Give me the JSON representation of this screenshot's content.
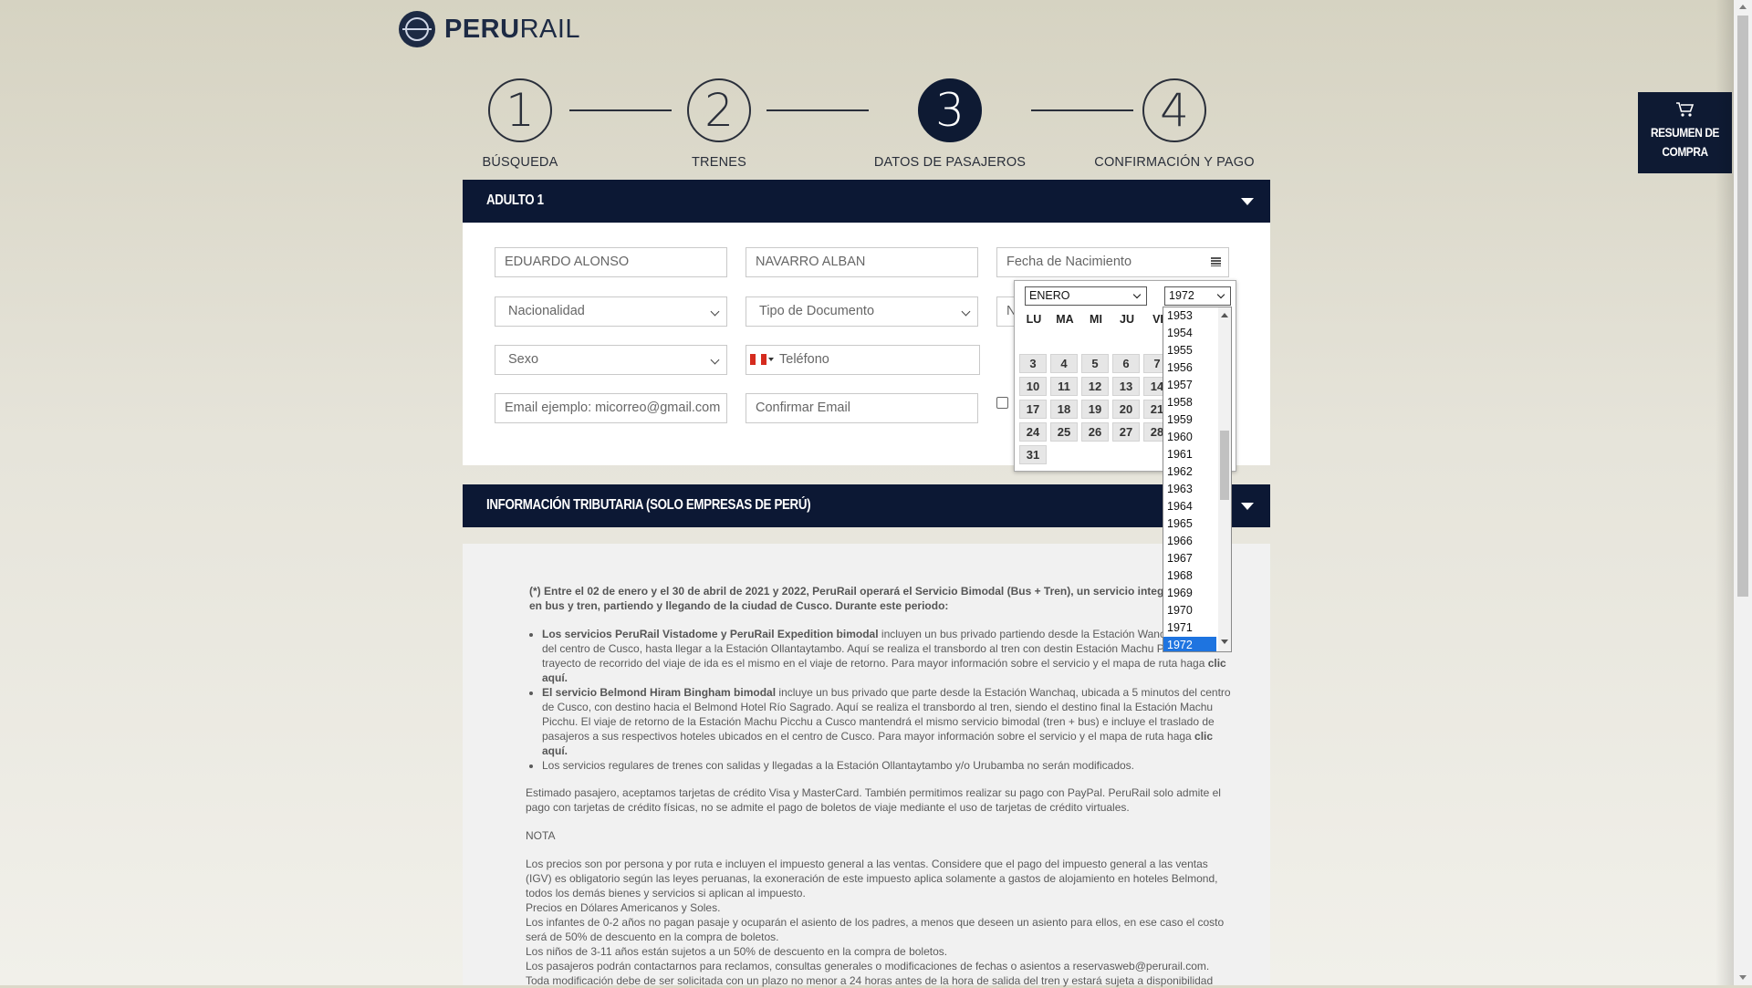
{
  "brand": {
    "bold": "PERU",
    "light": "RAIL"
  },
  "steps": [
    {
      "number": "1",
      "label": "BÚSQUEDA"
    },
    {
      "number": "2",
      "label": "TRENES"
    },
    {
      "number": "3",
      "label": "DATOS DE PASAJEROS"
    },
    {
      "number": "4",
      "label": "CONFIRMACIÓN Y PAGO"
    }
  ],
  "active_step": 3,
  "cart": {
    "line1": "RESUMEN DE",
    "line2": "COMPRA"
  },
  "passenger": {
    "title": "ADULTO 1",
    "first_name": "EDUARDO ALONSO",
    "last_name": "NAVARRO ALBAN",
    "birthdate_placeholder": "Fecha de Nacimiento",
    "nationality": "Nacionalidad",
    "document_type": "Tipo de Documento",
    "doc_number_partial": "N",
    "sex": "Sexo",
    "phone_placeholder": "Teléfono",
    "email_placeholder": "Email ejemplo: micorreo@gmail.com",
    "confirm_email_placeholder": "Confirmar Email"
  },
  "datepicker": {
    "month": "ENERO",
    "year": "1972",
    "weekdays": [
      "LU",
      "MA",
      "MI",
      "JU",
      "VI"
    ],
    "weeks": [
      [
        "",
        "",
        "",
        "",
        ""
      ],
      [
        "3",
        "4",
        "5",
        "6",
        "7"
      ],
      [
        "10",
        "11",
        "12",
        "13",
        "14"
      ],
      [
        "17",
        "18",
        "19",
        "20",
        "21"
      ],
      [
        "24",
        "25",
        "26",
        "27",
        "28"
      ],
      [
        "31",
        "",
        "",
        "",
        ""
      ]
    ],
    "year_options": [
      "1953",
      "1954",
      "1955",
      "1956",
      "1957",
      "1958",
      "1959",
      "1960",
      "1961",
      "1962",
      "1963",
      "1964",
      "1965",
      "1966",
      "1967",
      "1968",
      "1969",
      "1970",
      "1971",
      "1972"
    ],
    "selected_year": "1972"
  },
  "tax_section": {
    "title": "INFORMACIÓN TRIBUTARIA (SOLO EMPRESAS DE PERÚ)"
  },
  "info": {
    "lead": "(*) Entre el 02 de enero y el 30 de abril de 2021 y 2022, PeruRail operará el Servicio Bimodal (Bus + Tren), un servicio integral c",
    "lead_end": "el viaje en bus y tren, partiendo y llegando de la ciudad de Cusco. Durante este periodo:",
    "bullet1_bold": "Los servicios PeruRail Vistadome y PeruRail Expedition bimodal",
    "bullet1_text": " incluyen un bus privado partiendo desde la Estación Wancha",
    "bullet1_cont": "5 minutos del centro de Cusco, hasta llegar a la Estación Ollantaytambo. Aquí se realiza el transbordo al tren con destin",
    "bullet1_cont2": "Estación Machu Picchu. El trayecto de recorrido del viaje de ida es el mismo en el viaje de retorno. Para mayor información sobre el servicio y el mapa de ruta haga ",
    "bullet1_link": "clic aquí.",
    "bullet2_bold": "El servicio Belmond Hiram Bingham bimodal",
    "bullet2_text": " incluye un bus privado que parte desde la Estación Wanchaq, ubicada a 5 minutos del centro de Cusco, con destino hacia el Belmond Hotel Río Sagrado. Aquí se realiza el transbordo al tren, siendo el destino final la Estación Machu Picchu. El viaje de retorno de la Estación Machu Picchu a Cusco mantendrá el mismo servicio bimodal (tren + bus) e incluye el traslado de pasajeros a sus respectivos hoteles ubicados en el centro de Cusco. Para mayor información sobre el servicio y el mapa de ruta haga ",
    "bullet2_link": "clic aquí.",
    "bullet3": "Los servicios regulares de trenes con salidas y llegadas a la Estación Ollantaytambo y/o Urubamba no serán modificados.",
    "cards": "Estimado pasajero, aceptamos tarjetas de crédito Visa y MasterCard. También permitimos realizar su pago con PayPal. PeruRail solo admite el pago con tarjetas de crédito físicas, no se admite el pago de boletos de viaje mediante el uso de tarjetas de crédito virtuales.",
    "nota": "NOTA",
    "notes": [
      "Los precios son por persona y por ruta e incluyen el impuesto general a las ventas. Considere que el pago del impuesto general a las ventas (IGV) es obligatorio según las leyes peruanas, la exoneración de este impuesto aplica solamente a gastos de alojamiento en hoteles Belmond, todos los demás bienes y servicios si aplican al impuesto.",
      "Precios en Dólares Americanos y Soles.",
      "Los infantes de 0-2 años no pagan pasaje y ocuparán el asiento de los padres, a menos que deseen un asiento para ellos, en ese caso el costo será de 50% de descuento en la compra de boletos.",
      "Los niños de 3-11 años están sujetos a un 50% de descuento en la compra de boletos.",
      "Los pasajeros podrán contactarnos para reclamos, consultas generales o modificaciones de fechas o asientos a reservasweb@perurail.com.",
      "Toda modificación debe de ser solicitada con un plazo no menor a 24 horas antes de la hora de salida del tren y estará sujeta a disponibilidad"
    ]
  }
}
